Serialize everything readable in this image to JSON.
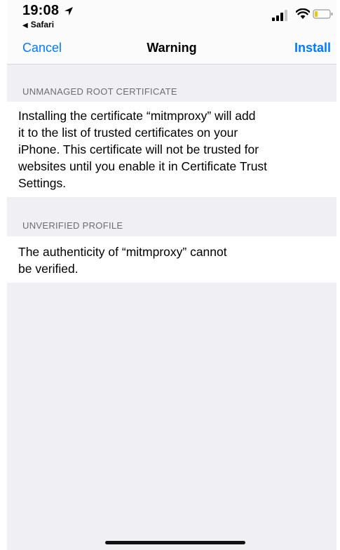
{
  "status_bar": {
    "time": "19:08",
    "back_app": "Safari"
  },
  "nav": {
    "cancel_label": "Cancel",
    "title": "Warning",
    "install_label": "Install"
  },
  "sections": [
    {
      "header": "UNMANAGED ROOT CERTIFICATE",
      "lines": [
        "Installing the certificate “mitmproxy” will add",
        "it to the list of trusted certificates on your",
        "iPhone. This certificate will not be trusted for",
        "websites until you enable it in Certificate Trust",
        "Settings."
      ]
    },
    {
      "header": "UNVERIFIED PROFILE",
      "lines": [
        "The authenticity of “mitmproxy” cannot",
        "be verified."
      ]
    }
  ],
  "colors": {
    "accent": "#007aff",
    "grouped_background": "#efeff4",
    "section_header_text": "#6d6d72"
  },
  "icons": {
    "location": "location-arrow-icon",
    "signal": "cellular-signal-icon",
    "wifi": "wifi-icon",
    "battery": "battery-icon"
  }
}
